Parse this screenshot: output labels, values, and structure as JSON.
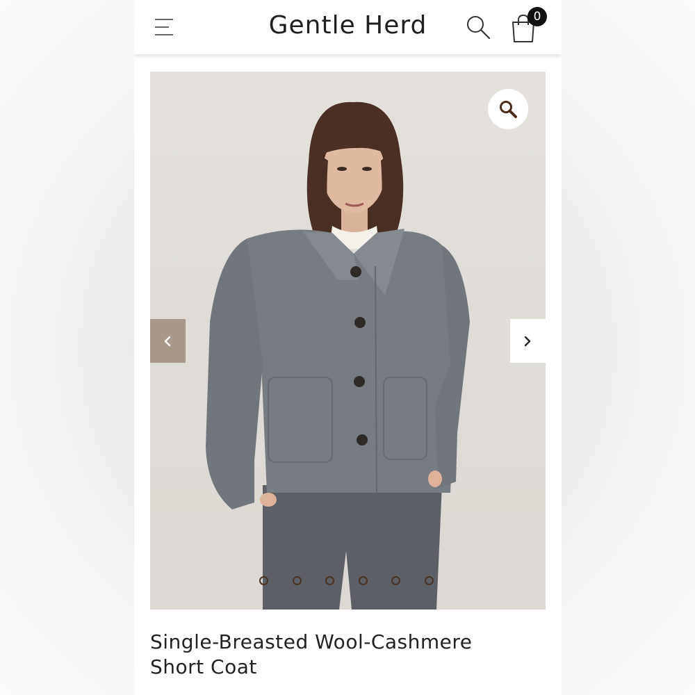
{
  "header": {
    "brand": "Gentle Herd",
    "menu_icon": "hamburger-menu-icon",
    "search_icon": "search-icon",
    "cart_icon": "shopping-bag-icon",
    "cart_count": "0"
  },
  "gallery": {
    "image_count": 6,
    "active_index": 0,
    "zoom_icon": "magnifier-icon",
    "prev_icon": "chevron-left-icon",
    "next_icon": "chevron-right-icon",
    "colors": {
      "prev_bg": "#a8998a",
      "dot_border": "#4a3222",
      "background": "#dedbd6"
    }
  },
  "product": {
    "title_line1": "Single-Breasted Wool-Cashmere",
    "title_line2": "Short Coat"
  }
}
